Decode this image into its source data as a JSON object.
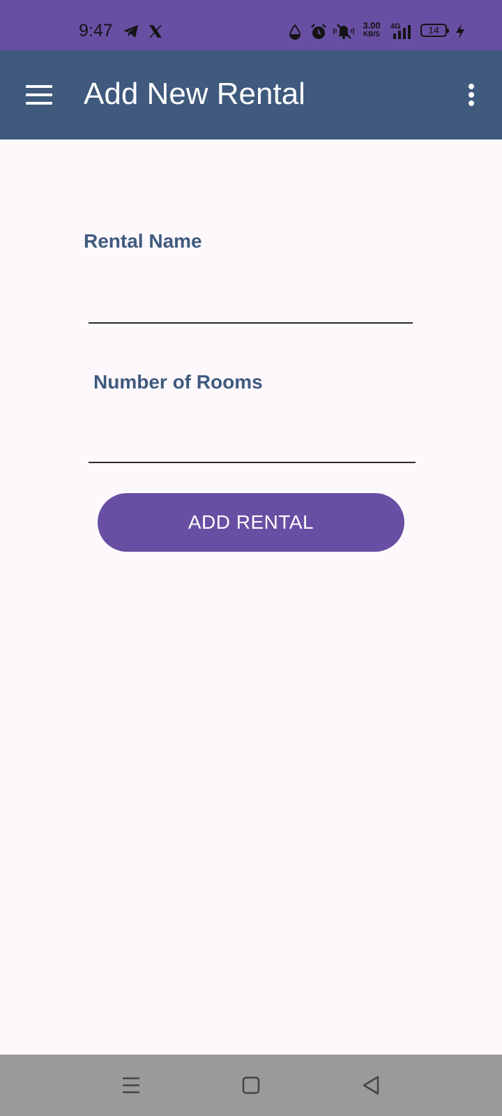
{
  "status_bar": {
    "time": "9:47",
    "net_speed": "3.00",
    "net_speed_unit": "KB/S",
    "network_type": "4G",
    "battery_level": "14",
    "icons": [
      "telegram-icon",
      "x-icon",
      "water-drop-icon",
      "alarm-icon",
      "vibrate-silent-icon",
      "signal-icon",
      "charging-icon"
    ]
  },
  "app_bar": {
    "title": "Add New Rental",
    "menu_icon": "hamburger-menu-icon",
    "overflow_icon": "more-vert-icon"
  },
  "form": {
    "rental_name_label": "Rental Name",
    "rental_name_value": "",
    "rooms_label": "Number of Rooms",
    "rooms_value": "",
    "submit_label": "ADD RENTAL"
  },
  "nav_bar": {
    "icons": [
      "recents-icon",
      "home-icon",
      "back-icon"
    ]
  },
  "colors": {
    "status_bar": "#684fa3",
    "app_bar": "#3f5a7d",
    "accent": "#684fa3",
    "label": "#3f5a7d",
    "background": "#fdf8fc",
    "nav_bar": "#9a9a9a"
  }
}
